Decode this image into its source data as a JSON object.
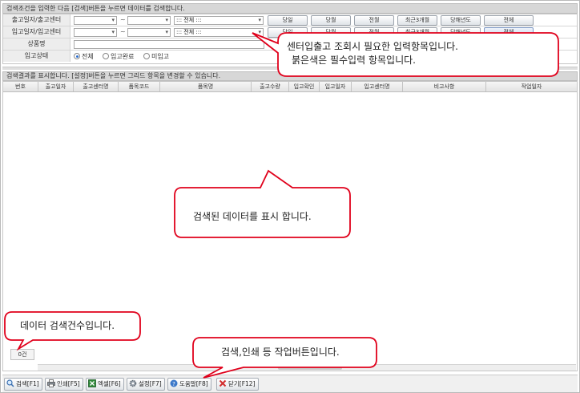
{
  "search": {
    "caption": "검색조건을 입력한 다음 [검색]버튼을 누르면 데이터를 검색합니다.",
    "rows": [
      {
        "label": "출고일자/출고센터",
        "tilde": "~",
        "center_value": "::: 전체 :::"
      },
      {
        "label": "입고일자/입고센터",
        "tilde": "~",
        "center_value": "::: 전체 :::"
      },
      {
        "label": "상품명"
      },
      {
        "label": "입고상태"
      }
    ],
    "period_buttons_row1": [
      "당일",
      "당월",
      "전월",
      "최근3개월",
      "당해년도",
      "전체"
    ],
    "period_buttons_row2": [
      "당일",
      "당월",
      "전월",
      "최근3개월",
      "당해년도",
      "전체"
    ],
    "status_options": [
      "전체",
      "입고완료",
      "미입고"
    ],
    "status_selected": "전체"
  },
  "results": {
    "caption": "검색결과를 표시합니다. [설정]버튼을 누르면 그리드 항목을 변경할 수 있습니다.",
    "columns": [
      "번호",
      "출고일자",
      "출고센터명",
      "품목코드",
      "품목명",
      "출고수량",
      "입고확인",
      "입고일자",
      "입고센터명",
      "비고사항",
      "작업일자"
    ],
    "rows": [],
    "count_label": "0건"
  },
  "toolbar": {
    "buttons": [
      {
        "label": "검색[F1]",
        "icon": "magnifier-icon"
      },
      {
        "label": "인쇄[F5]",
        "icon": "printer-icon"
      },
      {
        "label": "엑셀[F6]",
        "icon": "excel-icon"
      },
      {
        "label": "설정[F7]",
        "icon": "gear-icon"
      },
      {
        "label": "도움말[F8]",
        "icon": "help-icon"
      },
      {
        "label": "닫기[F12]",
        "icon": "close-icon"
      }
    ]
  },
  "callouts": {
    "search_line1": "센터입출고 조회시 필요한 입력항목입니다.",
    "search_line2": "붉은색은 필수입력 항목입니다.",
    "grid": "검색된 데이터를 표시 합니다.",
    "count": "데이터 검색건수입니다.",
    "toolbar": "검색,인쇄 등 작업버튼입니다."
  },
  "colors": {
    "callout_border": "#e0001b",
    "radio_selected": "#2d6fd0",
    "close_icon": "#d22d2d"
  }
}
